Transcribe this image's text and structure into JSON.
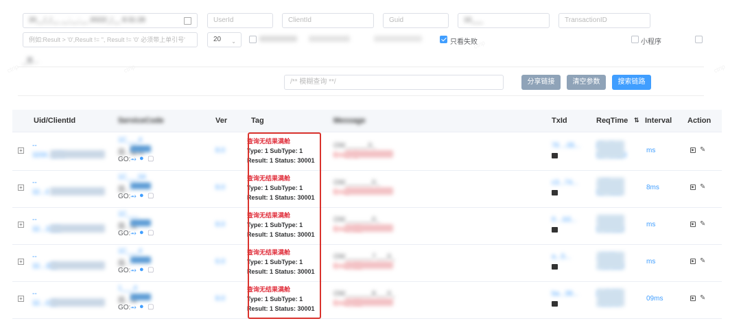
{
  "filters": {
    "row1": {
      "date_range": "20__/_/__ __:__:__  2022/_/__ 8:31:28",
      "userid": "UserId",
      "clientid": "ClientId",
      "guid": "Guid",
      "field5": "10___",
      "transaction_id": "TransactionID"
    },
    "row2": {
      "query": "例如:Result > '0',Result != '', Result != '0' 必须带上单引号'",
      "page_size": "20",
      "chk_wrong_label": "只看失败",
      "chk_mini_label": "小程序",
      "last_label": "_否..."
    }
  },
  "search": {
    "fuzzy_placeholder": "/** 模糊查询 **/",
    "share_button": "分享链接",
    "clear_button": "清空参数",
    "search_button": "搜索链路"
  },
  "columns": {
    "uid": "Uid/ClientId",
    "service": "ServiceCode",
    "ver": "Ver",
    "tag": "Tag",
    "message": "Message",
    "txid": "TxId",
    "reqtime": "ReqTime",
    "interval": "Interval",
    "action": "Action"
  },
  "rows": [
    {
      "uid_top": "--",
      "uid_bottom": "3200...279",
      "svc_top": "1C___4",
      "svc_mid": "国...服务",
      "go": "GO:",
      "ver": "8.0",
      "tag_title": "查询无结果满舱",
      "tag_line1": "Type: 1 SubType: 1",
      "tag_line2": "Result: 1 Status: 30001",
      "msg_top": "OW______0_",
      "msg_bottom": "Error...1",
      "tx": "76 ...05...",
      "time_top": "20...3",
      "time_bottom": "16...9.854",
      "interval": "ms"
    },
    {
      "uid_top": "--",
      "uid_bottom": "32...0",
      "svc_top": "1C___04",
      "svc_mid": "国...",
      "go": "GO:",
      "ver": "8.0",
      "tag_title": "查询无结果满舱",
      "tag_line1": "Type: 1 SubType: 1",
      "tag_line2": "Result: 1 Status: 30001",
      "msg_top": "OW_______0_",
      "msg_bottom": "Error",
      "tx": "c3...74...",
      "time_top": "...06",
      "time_bottom": "16...406",
      "interval": "8ms"
    },
    {
      "uid_top": "--",
      "uid_bottom": "32...3185",
      "svc_top": "1C___",
      "svc_mid": "国...务",
      "go": "GO:",
      "ver": "8.0",
      "tag_title": "查询无结果满舱",
      "tag_line1": "Type: 1 SubType: 1",
      "tag_line2": "Result: 1 Status: 30001",
      "msg_top": "OW_______0_",
      "msg_bottom": "Error...01",
      "tx": "9 ...b3...",
      "time_top": "...",
      "time_bottom": "1...0.530",
      "interval": "ms"
    },
    {
      "uid_top": "--",
      "uid_bottom": "32...393",
      "svc_top": "1C___4",
      "svc_mid": "国...",
      "go": "GO:",
      "ver": "6.0",
      "tag_title": "查询无结果满舱",
      "tag_line1": "Type: 1 SubType: 1",
      "tag_line2": "Result: 1 Status: 30001",
      "msg_top": "OW_______7___0_",
      "msg_bottom": "Error...01",
      "tx": "a...5...",
      "time_top": "...5-06",
      "time_bottom": "...19.360",
      "interval": "ms"
    },
    {
      "uid_top": "--",
      "uid_bottom": "32...018",
      "svc_top": "1___4",
      "svc_mid": "国...务",
      "go": "GO:",
      "ver": "8.0",
      "tag_title": "查询无结果满舱",
      "tag_line1": "Type: 1 SubType: 1",
      "tag_line2": "Result: 1 Status: 30001",
      "msg_top": "OW_______8___0_",
      "msg_bottom": "Error...01",
      "tx": "ba...39...",
      "time_top": "2...5-06",
      "time_bottom": "...8.370",
      "interval": "09ms"
    }
  ]
}
